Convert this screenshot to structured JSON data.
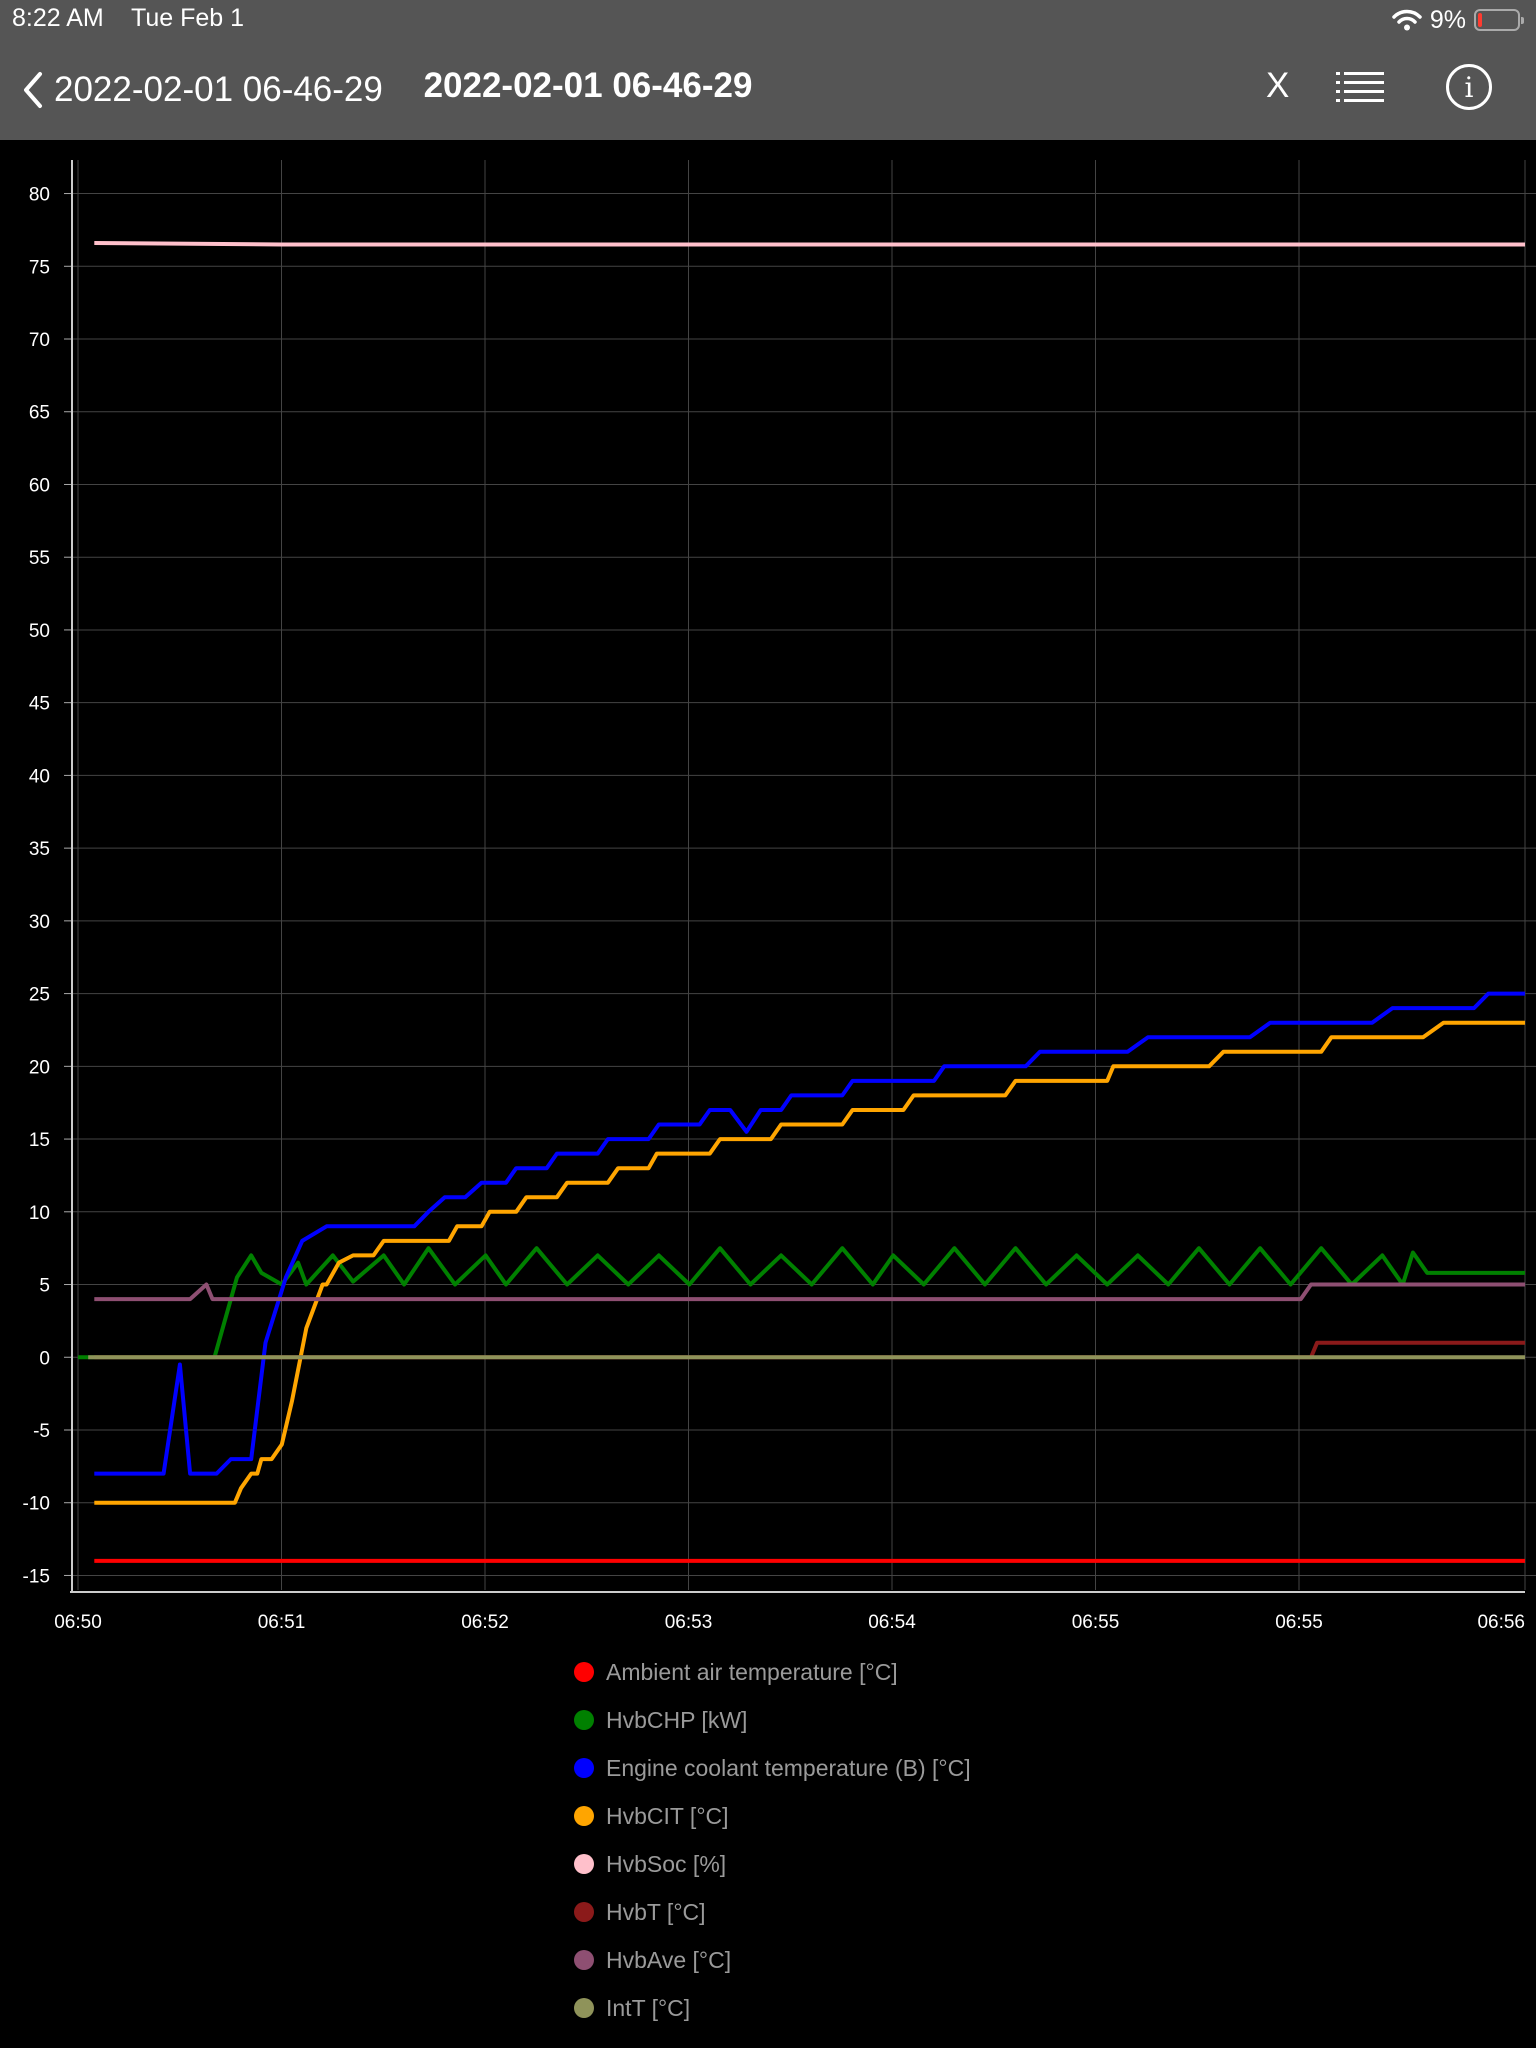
{
  "status_bar": {
    "time": "8:22 AM",
    "date": "Tue Feb 1",
    "battery": "9%"
  },
  "nav": {
    "back_label": "2022-02-01 06-46-29",
    "title": "2022-02-01 06-46-29",
    "close_label": "X",
    "info_label": "i"
  },
  "chart_data": {
    "type": "line",
    "x": [
      0,
      0.47,
      1.0,
      1.5,
      2.0,
      2.5,
      3.0,
      3.5,
      4.0,
      4.5,
      5.0,
      5.5,
      6.0,
      6.5,
      7.0
    ],
    "xticks": [
      "06:50",
      "06:51",
      "06:52",
      "06:53",
      "06:54",
      "06:55",
      "06:55",
      "06:56"
    ],
    "ylim": [
      -16,
      81
    ],
    "yticks": [
      -15,
      -10,
      -5,
      0,
      5,
      10,
      15,
      20,
      25,
      30,
      35,
      40,
      45,
      50,
      55,
      60,
      65,
      70,
      75,
      80
    ],
    "grid": true,
    "legend_position": "bottom",
    "series": [
      {
        "name": "Ambient air temperature [°C]",
        "color": "#ff0000",
        "points": [
          [
            0.08,
            -14
          ],
          [
            7.1,
            -14
          ]
        ]
      },
      {
        "name": "HvbCHP [kW]",
        "color": "#008000",
        "points": [
          [
            0.0,
            0
          ],
          [
            0.67,
            0
          ],
          [
            0.78,
            5.5
          ],
          [
            0.85,
            7
          ],
          [
            0.9,
            5.8
          ],
          [
            1.0,
            5
          ],
          [
            1.08,
            6.5
          ],
          [
            1.12,
            5
          ],
          [
            1.25,
            7
          ],
          [
            1.35,
            5.2
          ],
          [
            1.5,
            7
          ],
          [
            1.6,
            5
          ],
          [
            1.72,
            7.5
          ],
          [
            1.85,
            5
          ],
          [
            2.0,
            7
          ],
          [
            2.1,
            5
          ],
          [
            2.25,
            7.5
          ],
          [
            2.4,
            5
          ],
          [
            2.55,
            7
          ],
          [
            2.7,
            5
          ],
          [
            2.85,
            7
          ],
          [
            3.0,
            5
          ],
          [
            3.15,
            7.5
          ],
          [
            3.3,
            5
          ],
          [
            3.45,
            7
          ],
          [
            3.6,
            5
          ],
          [
            3.75,
            7.5
          ],
          [
            3.9,
            5
          ],
          [
            4.0,
            7
          ],
          [
            4.15,
            5
          ],
          [
            4.3,
            7.5
          ],
          [
            4.45,
            5
          ],
          [
            4.6,
            7.5
          ],
          [
            4.75,
            5
          ],
          [
            4.9,
            7
          ],
          [
            5.05,
            5
          ],
          [
            5.2,
            7
          ],
          [
            5.35,
            5
          ],
          [
            5.5,
            7.5
          ],
          [
            5.65,
            5
          ],
          [
            5.8,
            7.5
          ],
          [
            5.95,
            5
          ],
          [
            6.1,
            7.5
          ],
          [
            6.25,
            5
          ],
          [
            6.4,
            7
          ],
          [
            6.5,
            5
          ],
          [
            6.55,
            7.2
          ],
          [
            6.62,
            5.8
          ],
          [
            7.1,
            5.8
          ]
        ]
      },
      {
        "name": "Engine coolant temperature (B) [°C]",
        "color": "#0000ff",
        "points": [
          [
            0.08,
            -8
          ],
          [
            0.42,
            -8
          ],
          [
            0.5,
            -0.5
          ],
          [
            0.55,
            -8
          ],
          [
            0.68,
            -8
          ],
          [
            0.75,
            -7
          ],
          [
            0.85,
            -7
          ],
          [
            0.92,
            1
          ],
          [
            1.02,
            5.5
          ],
          [
            1.1,
            8
          ],
          [
            1.22,
            9
          ],
          [
            1.65,
            9
          ],
          [
            1.72,
            10
          ],
          [
            1.8,
            11
          ],
          [
            1.9,
            11
          ],
          [
            1.98,
            12
          ],
          [
            2.1,
            12
          ],
          [
            2.15,
            13
          ],
          [
            2.3,
            13
          ],
          [
            2.35,
            14
          ],
          [
            2.55,
            14
          ],
          [
            2.6,
            15
          ],
          [
            2.8,
            15
          ],
          [
            2.85,
            16
          ],
          [
            3.05,
            16
          ],
          [
            3.1,
            17
          ],
          [
            3.2,
            17
          ],
          [
            3.28,
            15.5
          ],
          [
            3.35,
            17
          ],
          [
            3.45,
            17
          ],
          [
            3.5,
            18
          ],
          [
            3.75,
            18
          ],
          [
            3.8,
            19
          ],
          [
            4.2,
            19
          ],
          [
            4.25,
            20
          ],
          [
            4.65,
            20
          ],
          [
            4.72,
            21
          ],
          [
            5.15,
            21
          ],
          [
            5.25,
            22
          ],
          [
            5.75,
            22
          ],
          [
            5.85,
            23
          ],
          [
            6.35,
            23
          ],
          [
            6.45,
            24
          ],
          [
            6.85,
            24
          ],
          [
            6.92,
            25
          ],
          [
            7.1,
            25
          ]
        ]
      },
      {
        "name": "HvbCIT [°C]",
        "color": "#ffa500",
        "points": [
          [
            0.08,
            -10
          ],
          [
            0.77,
            -10
          ],
          [
            0.8,
            -9
          ],
          [
            0.85,
            -8
          ],
          [
            0.88,
            -8
          ],
          [
            0.9,
            -7
          ],
          [
            0.95,
            -7
          ],
          [
            1.0,
            -6
          ],
          [
            1.05,
            -3
          ],
          [
            1.12,
            2
          ],
          [
            1.2,
            5
          ],
          [
            1.22,
            5
          ],
          [
            1.28,
            6.5
          ],
          [
            1.35,
            7
          ],
          [
            1.45,
            7
          ],
          [
            1.5,
            8
          ],
          [
            1.82,
            8
          ],
          [
            1.86,
            9
          ],
          [
            1.98,
            9
          ],
          [
            2.02,
            10
          ],
          [
            2.15,
            10
          ],
          [
            2.2,
            11
          ],
          [
            2.35,
            11
          ],
          [
            2.4,
            12
          ],
          [
            2.6,
            12
          ],
          [
            2.65,
            13
          ],
          [
            2.8,
            13
          ],
          [
            2.84,
            14
          ],
          [
            3.1,
            14
          ],
          [
            3.15,
            15
          ],
          [
            3.4,
            15
          ],
          [
            3.45,
            16
          ],
          [
            3.75,
            16
          ],
          [
            3.8,
            17
          ],
          [
            4.05,
            17
          ],
          [
            4.1,
            18
          ],
          [
            4.55,
            18
          ],
          [
            4.6,
            19
          ],
          [
            5.05,
            19
          ],
          [
            5.08,
            20
          ],
          [
            5.55,
            20
          ],
          [
            5.62,
            21
          ],
          [
            6.1,
            21
          ],
          [
            6.15,
            22
          ],
          [
            6.6,
            22
          ],
          [
            6.7,
            23
          ],
          [
            7.1,
            23
          ]
        ]
      },
      {
        "name": "HvbSoc [%]",
        "color": "#ffc0cb",
        "points": [
          [
            0.08,
            76.6
          ],
          [
            1.0,
            76.5
          ],
          [
            7.1,
            76.5
          ]
        ]
      },
      {
        "name": "HvbT [°C]",
        "color": "#8b1a1a",
        "points": [
          [
            0.08,
            0
          ],
          [
            6.05,
            0
          ],
          [
            6.08,
            1
          ],
          [
            7.1,
            1
          ]
        ]
      },
      {
        "name": "HvbAve [°C]",
        "color": "#8e4f72",
        "points": [
          [
            0.08,
            4
          ],
          [
            0.55,
            4
          ],
          [
            0.63,
            5
          ],
          [
            0.66,
            4
          ],
          [
            6.0,
            4
          ],
          [
            6.05,
            5
          ],
          [
            7.1,
            5
          ]
        ]
      },
      {
        "name": "IntT [°C]",
        "color": "#8f935a",
        "points": [
          [
            0.05,
            0
          ],
          [
            7.1,
            0
          ]
        ]
      }
    ]
  }
}
